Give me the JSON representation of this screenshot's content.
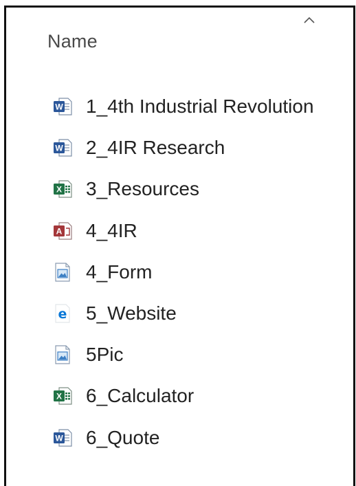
{
  "column_header": {
    "label": "Name",
    "sort_direction": "ascending",
    "sort_icon": "chevron-up-icon"
  },
  "files": [
    {
      "name": "1_4th Industrial Revolution",
      "type": "word",
      "icon": "word-document-icon"
    },
    {
      "name": "2_4IR Research",
      "type": "word",
      "icon": "word-document-icon"
    },
    {
      "name": "3_Resources",
      "type": "excel",
      "icon": "excel-workbook-icon"
    },
    {
      "name": "4_4IR",
      "type": "access",
      "icon": "access-database-icon"
    },
    {
      "name": "4_Form",
      "type": "image",
      "icon": "image-file-icon"
    },
    {
      "name": "5_Website",
      "type": "html",
      "icon": "edge-html-icon"
    },
    {
      "name": "5Pic",
      "type": "image",
      "icon": "image-file-icon"
    },
    {
      "name": "6_Calculator",
      "type": "excel",
      "icon": "excel-workbook-icon"
    },
    {
      "name": "6_Quote",
      "type": "word",
      "icon": "word-document-icon"
    }
  ],
  "colors": {
    "word": "#2b579a",
    "excel": "#217346",
    "access": "#a4373a",
    "image": "#3c7fc4",
    "edge": "#0a78d7"
  }
}
